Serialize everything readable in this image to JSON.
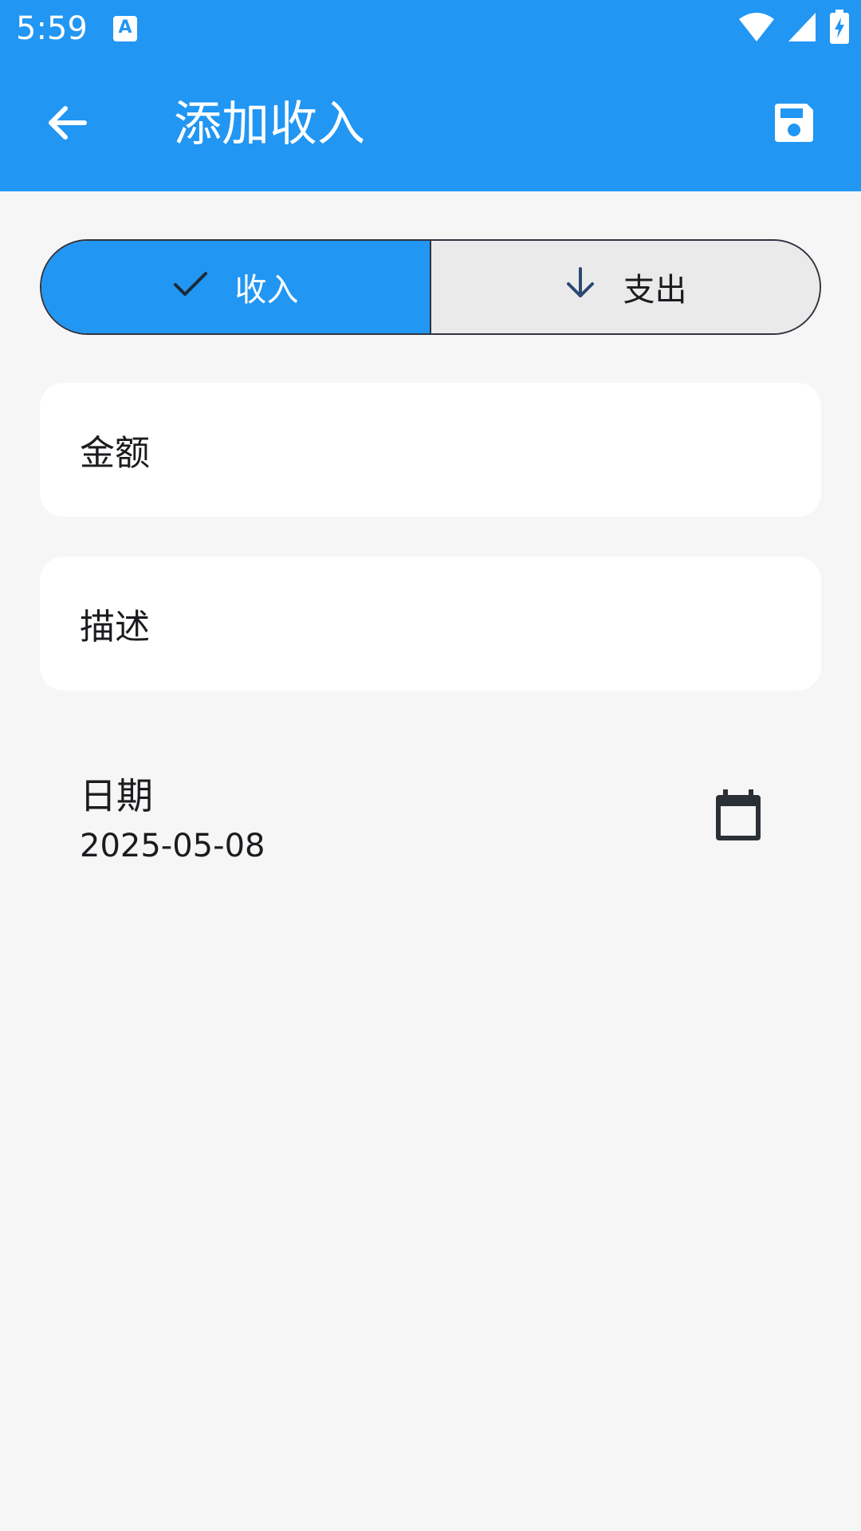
{
  "status_bar": {
    "time": "5:59",
    "notification_icon_letter": "A",
    "icons": [
      "wifi-icon",
      "signal-icon",
      "battery-charging-icon"
    ]
  },
  "toolbar": {
    "title": "添加收入",
    "back_icon": "arrow-left-icon",
    "save_icon": "floppy-disk-icon"
  },
  "type_toggle": {
    "options": [
      {
        "label": "收入",
        "icon": "check-icon",
        "selected": true
      },
      {
        "label": "支出",
        "icon": "arrow-down-icon",
        "selected": false
      }
    ]
  },
  "form": {
    "amount_label": "金额",
    "description_label": "描述",
    "date_label": "日期",
    "date_value": "2025-05-08",
    "calendar_icon": "calendar-icon"
  },
  "colors": {
    "primary": "#2196f3",
    "background": "#f7f6f6",
    "field_background": "#ffffff",
    "unselected_segment": "#ebeaea",
    "text": "#1c1b1f"
  }
}
